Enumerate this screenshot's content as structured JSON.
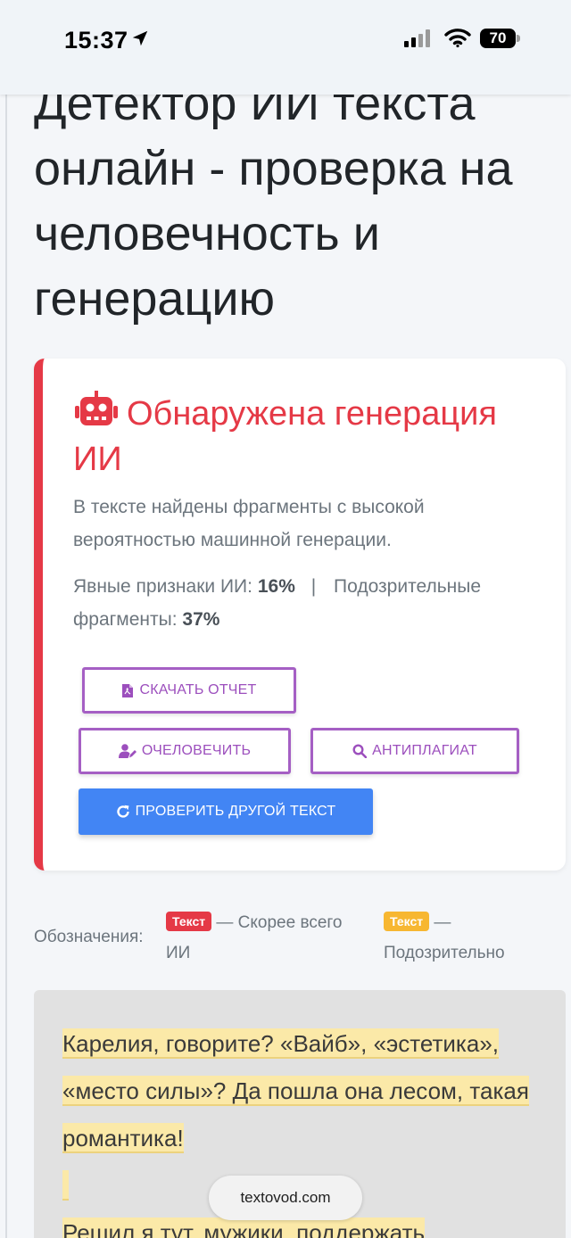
{
  "status_bar": {
    "time": "15:37",
    "battery": "70"
  },
  "page": {
    "title": "Детектор ИИ текста онлайн - проверка на человечность и генерацию"
  },
  "result": {
    "title": "Обнаружена генерация ИИ",
    "description": "В тексте найдены фрагменты с высокой вероятностью машинной генерации.",
    "explicit_label": "Явные признаки ИИ:",
    "explicit_value": "16%",
    "separator": "|",
    "suspicious_label": "Подозрительные фрагменты:",
    "suspicious_value": "37%",
    "accent_color": "#e53946"
  },
  "buttons": {
    "download": "СКАЧАТЬ ОТЧЕТ",
    "humanize": "ОЧЕЛОВЕЧИТЬ",
    "antiplagiat": "АНТИПЛАГИАТ",
    "check_other": "ПРОВЕРИТЬ ДРУГОЙ ТЕКСТ",
    "outline_color": "#a55fc4",
    "primary_color": "#4285f4"
  },
  "legend": {
    "label": "Обозначения:",
    "ai_badge": "Текст",
    "ai_text": "— Скорее всего ИИ",
    "suspicious_badge": "Текст",
    "suspicious_text": "— Подозрительно"
  },
  "text": {
    "line1": "Карелия, говорите? «Вайб», «эстетика», «место силы»? Да пошла она лесом, такая романтика!",
    "line2": "Решил я тут, мужики, поддержать"
  },
  "browser": {
    "url": "textovod.com"
  }
}
